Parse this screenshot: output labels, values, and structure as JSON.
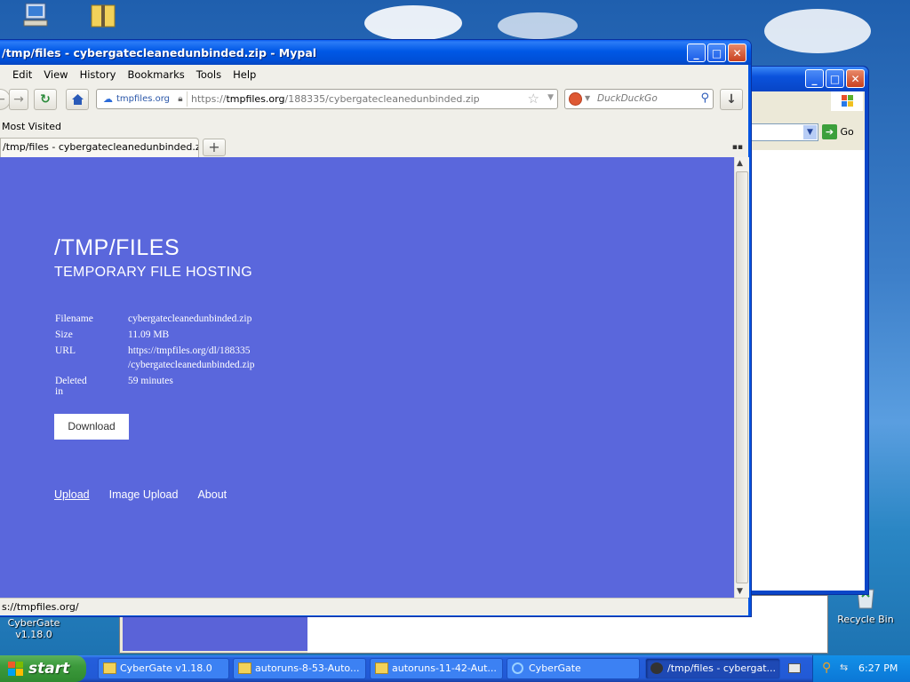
{
  "desktop": {
    "icons": [
      {
        "label": "CyberGate v1.18.0"
      },
      {
        "label": "Recycle Bin"
      }
    ]
  },
  "browser": {
    "window_title": "/tmp/files - cybergatecleanedunbinded.zip - Mypal",
    "menu": [
      "Edit",
      "View",
      "History",
      "Bookmarks",
      "Tools",
      "Help"
    ],
    "identity_label": "tmpfiles.org",
    "url_prefix": "https://",
    "url_host": "tmpfiles.org",
    "url_path": "/188335/cybergatecleanedunbinded.zip",
    "search_placeholder": "DuckDuckGo",
    "bookmarks_item": "Most Visited",
    "tab_title": "/tmp/files - cybergatecleanedunbinded.zip",
    "new_tab": "+",
    "status_text": "s://tmpfiles.org/"
  },
  "page": {
    "title": "/TMP/FILES",
    "subtitle": "TEMPORARY FILE HOSTING",
    "info": {
      "filename_key": "Filename",
      "filename_val": "cybergatecleanedunbinded.zip",
      "size_key": "Size",
      "size_val": "11.09 MB",
      "url_key": "URL",
      "url_val_1": "https://tmpfiles.org/dl/188335",
      "url_val_2": "/cybergatecleanedunbinded.zip",
      "deleted_key": "Deleted in",
      "deleted_val": "59 minutes"
    },
    "download_label": "Download",
    "links": [
      "Upload",
      "Image Upload",
      "About"
    ],
    "bg_color": "#5a67dc"
  },
  "explorer": {
    "go_label": "Go"
  },
  "taskbar": {
    "start_label": "start",
    "buttons": [
      "CyberGate v1.18.0",
      "autoruns-8-53-Auto...",
      "autoruns-11-42-Aut...",
      "CyberGate",
      "/tmp/files - cybergat..."
    ],
    "clock": "6:27 PM"
  }
}
